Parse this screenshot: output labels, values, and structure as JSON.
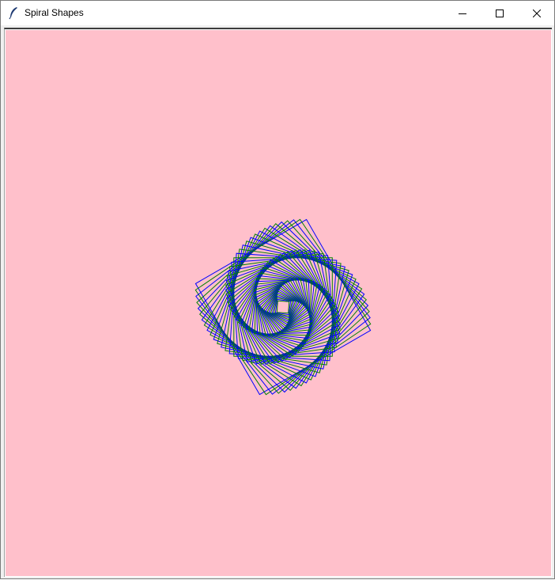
{
  "window": {
    "title": "Spiral Shapes",
    "icons": {
      "app": "feather-icon",
      "minimize": "minimize-icon",
      "maximize": "maximize-icon",
      "close": "close-icon"
    }
  },
  "canvas": {
    "background": "#ffc0cb",
    "shapes": {
      "type": "rotated-squares-spiral",
      "colors": [
        "#0000ff",
        "#008000"
      ],
      "count": 60
    }
  }
}
